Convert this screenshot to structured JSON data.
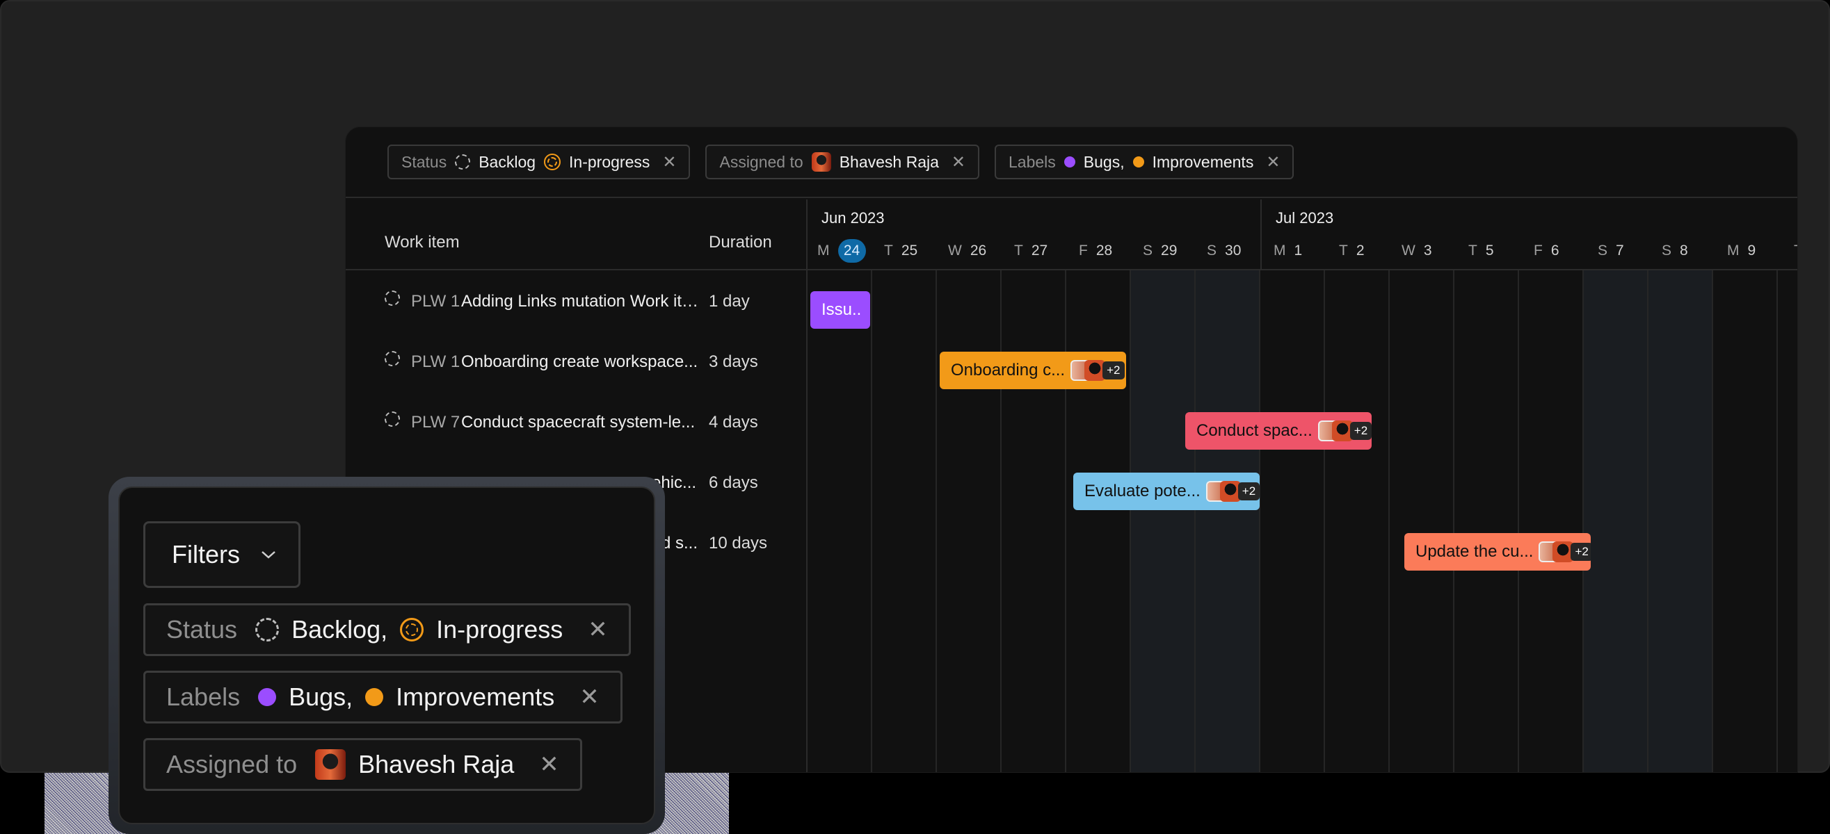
{
  "filterbar": {
    "status": {
      "label": "Status",
      "values": [
        "Backlog",
        "In-progress"
      ]
    },
    "assigned": {
      "label": "Assigned to",
      "value": "Bhavesh Raja"
    },
    "labels": {
      "label": "Labels",
      "values": [
        "Bugs,",
        "Improvements"
      ]
    }
  },
  "list": {
    "col_work_item": "Work item",
    "col_duration": "Duration",
    "rows": [
      {
        "id": "PLW 1",
        "title": "Adding Links mutation Work items",
        "duration": "1 day"
      },
      {
        "id": "PLW 1",
        "title": "Onboarding create workspace...",
        "duration": "3 days"
      },
      {
        "id": "PLW 7",
        "title": "Conduct spacecraft system-le...",
        "duration": "4 days"
      },
      {
        "id": "",
        "title": "ehic...",
        "duration": "6 days"
      },
      {
        "id": "",
        "title": "d s...",
        "duration": "10 days"
      }
    ]
  },
  "timeline": {
    "months": [
      "Jun 2023",
      "Jul 2023"
    ],
    "days": [
      {
        "l": "M",
        "d": "24"
      },
      {
        "l": "T",
        "d": "25"
      },
      {
        "l": "W",
        "d": "26"
      },
      {
        "l": "T",
        "d": "27"
      },
      {
        "l": "F",
        "d": "28"
      },
      {
        "l": "S",
        "d": "29"
      },
      {
        "l": "S",
        "d": "30"
      },
      {
        "l": "M",
        "d": "1"
      },
      {
        "l": "T",
        "d": "2"
      },
      {
        "l": "W",
        "d": "3"
      },
      {
        "l": "T",
        "d": "5"
      },
      {
        "l": "F",
        "d": "6"
      },
      {
        "l": "S",
        "d": "7"
      },
      {
        "l": "S",
        "d": "8"
      },
      {
        "l": "M",
        "d": "9"
      },
      {
        "l": "T",
        "d": ""
      }
    ],
    "bars": [
      {
        "text": "Issu..",
        "color": "#9b4dff"
      },
      {
        "text": "Onboarding c...",
        "color": "#f29a18",
        "extra": "+2"
      },
      {
        "text": "Conduct spac...",
        "color": "#ee5469",
        "extra": "+2"
      },
      {
        "text": "Evaluate pote...",
        "color": "#77c2ea",
        "extra": "+2"
      },
      {
        "text": "Update the cu...",
        "color": "#fb7b59",
        "extra": "+2"
      }
    ]
  },
  "panel": {
    "filters_button": "Filters",
    "status": {
      "label": "Status",
      "values": [
        "Backlog,",
        "In-progress"
      ]
    },
    "labels": {
      "label": "Labels",
      "values": [
        "Bugs,",
        "Improvements"
      ]
    },
    "assigned": {
      "label": "Assigned to",
      "value": "Bhavesh Raja"
    }
  },
  "colors": {
    "bugs": "#9b4dff",
    "improvements": "#f29a18",
    "today": "#0f6aa6"
  }
}
